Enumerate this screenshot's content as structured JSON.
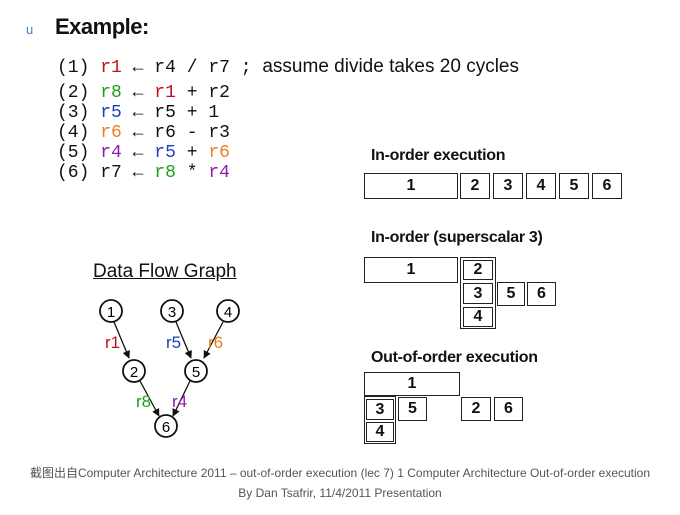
{
  "bullet": "u",
  "heading": "Example:",
  "code": [
    {
      "num": "(1)",
      "dst": "r1",
      "src1": "r4",
      "op": "/",
      "src2": "r7",
      "semi": ";",
      "comment": "assume divide takes 20 cycles"
    },
    {
      "num": "(2)",
      "dst": "r8",
      "src1": "r1",
      "op": "+",
      "src2": "r2"
    },
    {
      "num": "(3)",
      "dst": "r5",
      "src1": "r5",
      "op": "+",
      "src2": "1"
    },
    {
      "num": "(4)",
      "dst": "r6",
      "src1": "r6",
      "op": "-",
      "src2": "r3"
    },
    {
      "num": "(5)",
      "dst": "r4",
      "src1": "r5",
      "op": "+",
      "src2": "r6"
    },
    {
      "num": "(6)",
      "dst": "r7",
      "src1": "r8",
      "op": "*",
      "src2": "r4"
    }
  ],
  "arrow": "←",
  "inorder": {
    "title": "In-order execution",
    "cells": [
      "1",
      "2",
      "3",
      "4",
      "5",
      "6"
    ]
  },
  "superscalar": {
    "title": "In-order (superscalar 3)",
    "cells": [
      "1",
      "2",
      "3",
      "5",
      "6",
      "4"
    ]
  },
  "ooo": {
    "title": "Out-of-order execution",
    "cells": [
      "1",
      "3",
      "5",
      "2",
      "6",
      "4"
    ]
  },
  "dfg": {
    "title": "Data Flow Graph",
    "nodes": [
      "1",
      "3",
      "4",
      "2",
      "5",
      "6"
    ],
    "edge_labels": [
      "r1",
      "r5",
      "r6",
      "r8",
      "r4"
    ]
  },
  "colors": {
    "r1": "#c0101a",
    "r8": "#18a018",
    "r5": "#1f3fb8",
    "r6": "#e8801c",
    "r4": "#8a1ab0"
  },
  "caption": {
    "line1": "截图出自Computer Architecture 2011 – out-of-order execution (lec 7) 1 Computer Architecture Out-of-order execution",
    "line2": "By Dan Tsafrir, 11/4/2011 Presentation"
  }
}
